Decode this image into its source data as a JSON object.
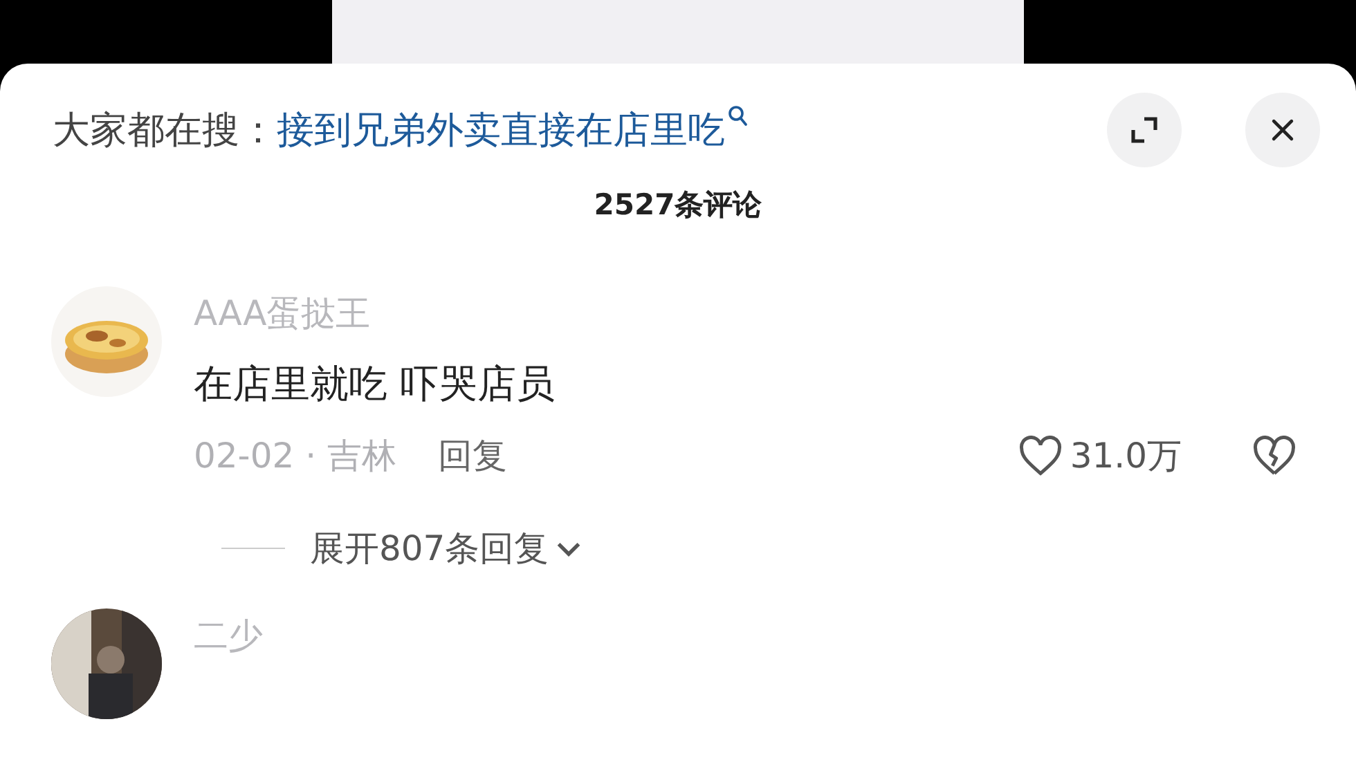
{
  "search_bar": {
    "label": "大家都在搜：",
    "query": "接到兄弟外卖直接在店里吃"
  },
  "comment_count": "2527条评论",
  "comments": [
    {
      "user": "AAA蛋挞王",
      "text": "在店里就吃 吓哭店员",
      "date": "02-02 · 吉林",
      "reply": "回复",
      "likes": "31.0万",
      "liked": false,
      "expand": "展开807条回复"
    },
    {
      "user": "二少"
    }
  ]
}
